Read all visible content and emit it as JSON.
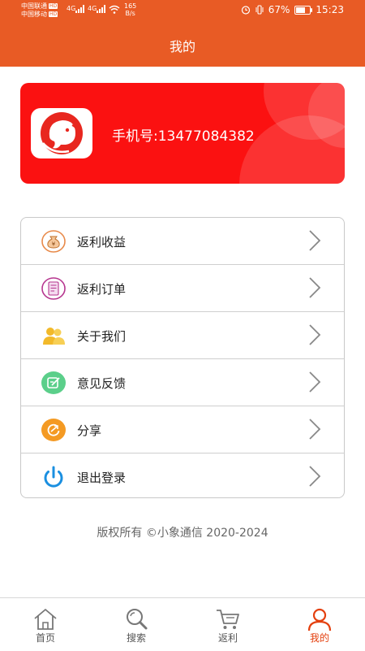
{
  "status_bar": {
    "carrier1": "中国联通",
    "carrier2": "中国移动",
    "hd": "HD",
    "signal1": "4G",
    "signal2": "4G",
    "net_speed_value": "165",
    "net_speed_unit": "B/s",
    "battery_percent": "67%",
    "battery_level": 0.67,
    "time": "15:23"
  },
  "header": {
    "title": "我的"
  },
  "profile": {
    "phone_label": "手机号:13477084382"
  },
  "menu": {
    "items": [
      {
        "label": "返利收益",
        "icon": "money-bag-icon"
      },
      {
        "label": "返利订单",
        "icon": "order-list-icon"
      },
      {
        "label": "关于我们",
        "icon": "users-icon"
      },
      {
        "label": "意见反馈",
        "icon": "feedback-icon"
      },
      {
        "label": "分享",
        "icon": "share-icon"
      },
      {
        "label": "退出登录",
        "icon": "power-icon"
      }
    ]
  },
  "footer": {
    "copyright": "版权所有 ©小象通信 2020-2024"
  },
  "tabbar": {
    "items": [
      {
        "label": "首页",
        "icon": "home-icon"
      },
      {
        "label": "搜索",
        "icon": "search-icon"
      },
      {
        "label": "返利",
        "icon": "cart-icon"
      },
      {
        "label": "我的",
        "icon": "user-icon",
        "active": true
      }
    ]
  },
  "colors": {
    "header_bg": "#e85b25",
    "card_bg": "#fb1111",
    "active_tab": "#e4400f"
  }
}
